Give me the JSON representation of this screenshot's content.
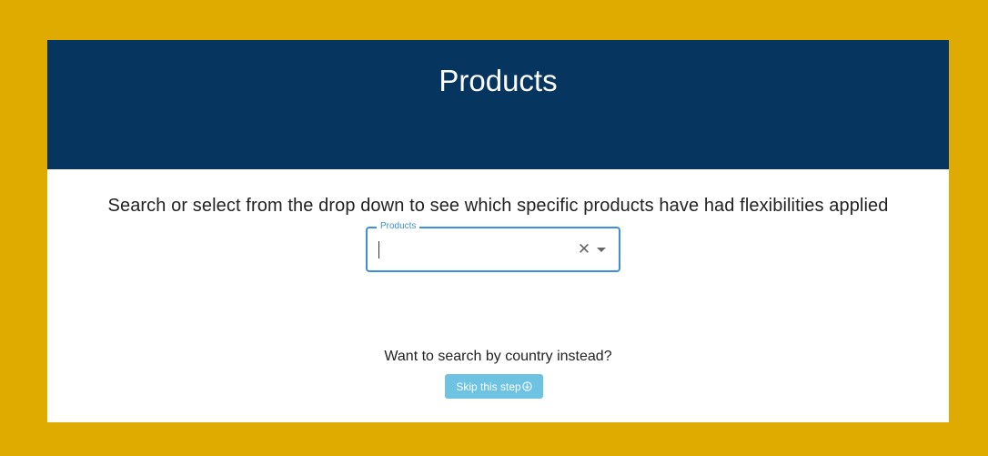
{
  "header": {
    "title": "Products"
  },
  "main": {
    "prompt": "Search or select from the drop down to see which specific products have had flexibilities applied",
    "products_field": {
      "label": "Products",
      "value": "",
      "clear_icon": "close-icon",
      "dropdown_icon": "arrow-drop-down-icon"
    },
    "alt_question": "Want to search by country instead?",
    "skip_button": {
      "label": "Skip this step",
      "icon": "arrow-down-circle-icon"
    }
  },
  "colors": {
    "frame": "#e0ab00",
    "header_bg": "#063560",
    "accent": "#3d8fd6",
    "skip_button_bg": "#6ec3e2"
  }
}
